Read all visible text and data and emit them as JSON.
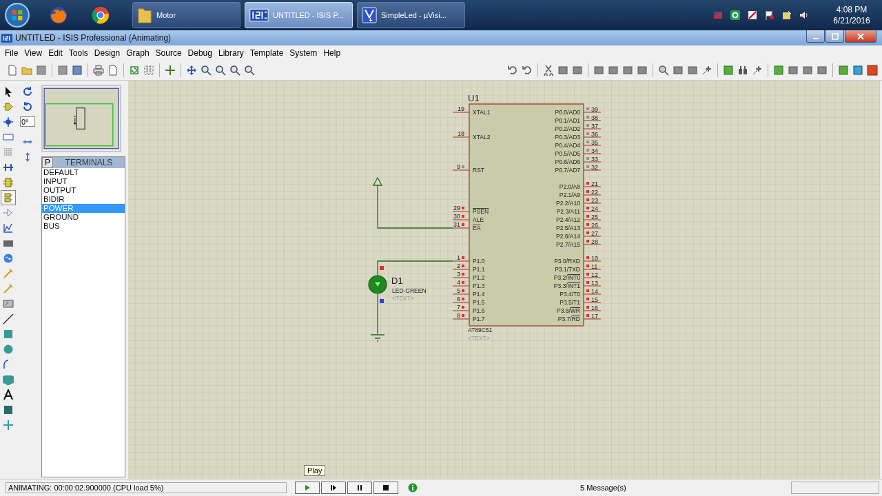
{
  "taskbar": {
    "tasks": [
      {
        "label": "Motor",
        "selected": false,
        "kind": "folder"
      },
      {
        "label": "UNTITLED - ISIS P...",
        "selected": true,
        "kind": "isis"
      },
      {
        "label": "SimpleLed  - µVisi...",
        "selected": false,
        "kind": "uvision"
      }
    ],
    "clock": {
      "time": "4:08 PM",
      "date": "6/21/2016"
    }
  },
  "window": {
    "title": "UNTITLED - ISIS Professional (Animating)"
  },
  "menu": [
    "File",
    "View",
    "Edit",
    "Tools",
    "Design",
    "Graph",
    "Source",
    "Debug",
    "Library",
    "Template",
    "System",
    "Help"
  ],
  "rotation": {
    "value": "0°"
  },
  "terminals": {
    "tab": "P",
    "title": "TERMINALS",
    "items": [
      {
        "label": "DEFAULT",
        "selected": false
      },
      {
        "label": "INPUT",
        "selected": false
      },
      {
        "label": "OUTPUT",
        "selected": false
      },
      {
        "label": "BIDIR",
        "selected": false
      },
      {
        "label": "POWER",
        "selected": true
      },
      {
        "label": "GROUND",
        "selected": false
      },
      {
        "label": "BUS",
        "selected": false
      }
    ]
  },
  "schematic": {
    "chip": {
      "ref": "U1",
      "part": "AT89C51",
      "text": "<TEXT>",
      "left_pins": [
        {
          "number": "19",
          "name": "XTAL1",
          "active_low": false
        },
        {
          "number": "18",
          "name": "XTAL2",
          "active_low": false
        },
        {
          "number": "9",
          "name": "RST",
          "color": "#909090",
          "active_low": false
        },
        {
          "number": "29",
          "name": "PSEN",
          "color": "#e03030",
          "active_low": true
        },
        {
          "number": "30",
          "name": "ALE",
          "color": "#e03030",
          "active_low": false
        },
        {
          "number": "31",
          "name": "EA",
          "color": "#e03030",
          "active_low": true
        },
        {
          "number": "1",
          "name": "P1.0",
          "color": "#e03030",
          "active_low": false
        },
        {
          "number": "2",
          "name": "P1.1",
          "color": "#e03030",
          "active_low": false
        },
        {
          "number": "3",
          "name": "P1.2",
          "color": "#e03030",
          "active_low": false
        },
        {
          "number": "4",
          "name": "P1.3",
          "color": "#e03030",
          "active_low": false
        },
        {
          "number": "5",
          "name": "P1.4",
          "color": "#e03030",
          "active_low": false
        },
        {
          "number": "6",
          "name": "P1.5",
          "color": "#e03030",
          "active_low": false
        },
        {
          "number": "7",
          "name": "P1.6",
          "color": "#e03030",
          "active_low": false
        },
        {
          "number": "8",
          "name": "P1.7",
          "color": "#e03030",
          "active_low": false
        }
      ],
      "right_pins": [
        {
          "number": "39",
          "name": "P0.0/AD0",
          "color": "#909090",
          "active_low": false
        },
        {
          "number": "38",
          "name": "P0.1/AD1",
          "color": "#909090",
          "active_low": false
        },
        {
          "number": "37",
          "name": "P0.2/AD2",
          "color": "#909090",
          "active_low": false
        },
        {
          "number": "36",
          "name": "P0.3/AD3",
          "color": "#909090",
          "active_low": false
        },
        {
          "number": "35",
          "name": "P0.4/AD4",
          "color": "#909090",
          "active_low": false
        },
        {
          "number": "34",
          "name": "P0.5/AD5",
          "color": "#909090",
          "active_low": false
        },
        {
          "number": "33",
          "name": "P0.6/AD6",
          "color": "#909090",
          "active_low": false
        },
        {
          "number": "32",
          "name": "P0.7/AD7",
          "color": "#909090",
          "active_low": false
        },
        {
          "number": "21",
          "name": "P2.0/A8",
          "color": "#e03030",
          "active_low": false
        },
        {
          "number": "22",
          "name": "P2.1/A9",
          "color": "#e03030",
          "active_low": false
        },
        {
          "number": "23",
          "name": "P2.2/A10",
          "color": "#e03030",
          "active_low": false
        },
        {
          "number": "24",
          "name": "P2.3/A11",
          "color": "#e03030",
          "active_low": false
        },
        {
          "number": "25",
          "name": "P2.4/A12",
          "color": "#e03030",
          "active_low": false
        },
        {
          "number": "26",
          "name": "P2.5/A13",
          "color": "#e03030",
          "active_low": false
        },
        {
          "number": "27",
          "name": "P2.6/A14",
          "color": "#e03030",
          "active_low": false
        },
        {
          "number": "28",
          "name": "P2.7/A15",
          "color": "#e03030",
          "active_low": false
        },
        {
          "number": "10",
          "name": "P3.0/RXD",
          "color": "#e03030",
          "active_low": false
        },
        {
          "number": "11",
          "name": "P3.1/TXD",
          "color": "#e03030",
          "active_low": false
        },
        {
          "number": "12",
          "name": "P3.2/INT0",
          "color": "#e03030",
          "active_low": true
        },
        {
          "number": "13",
          "name": "P3.3/INT1",
          "color": "#e03030",
          "active_low": true
        },
        {
          "number": "14",
          "name": "P3.4/T0",
          "color": "#e03030",
          "active_low": false
        },
        {
          "number": "15",
          "name": "P3.5/T1",
          "color": "#e03030",
          "active_low": false
        },
        {
          "number": "16",
          "name": "P3.6/WR",
          "color": "#e03030",
          "active_low": true
        },
        {
          "number": "17",
          "name": "P3.7/RD",
          "color": "#e03030",
          "active_low": true
        }
      ]
    },
    "led": {
      "ref": "D1",
      "part": "LED-GREEN",
      "text": "<TEXT>",
      "lit": true
    }
  },
  "simulation": {
    "status": "ANIMATING: 00:00:02.900000 (CPU load 5%)",
    "tooltip": "Play",
    "messages": "5 Message(s)"
  }
}
